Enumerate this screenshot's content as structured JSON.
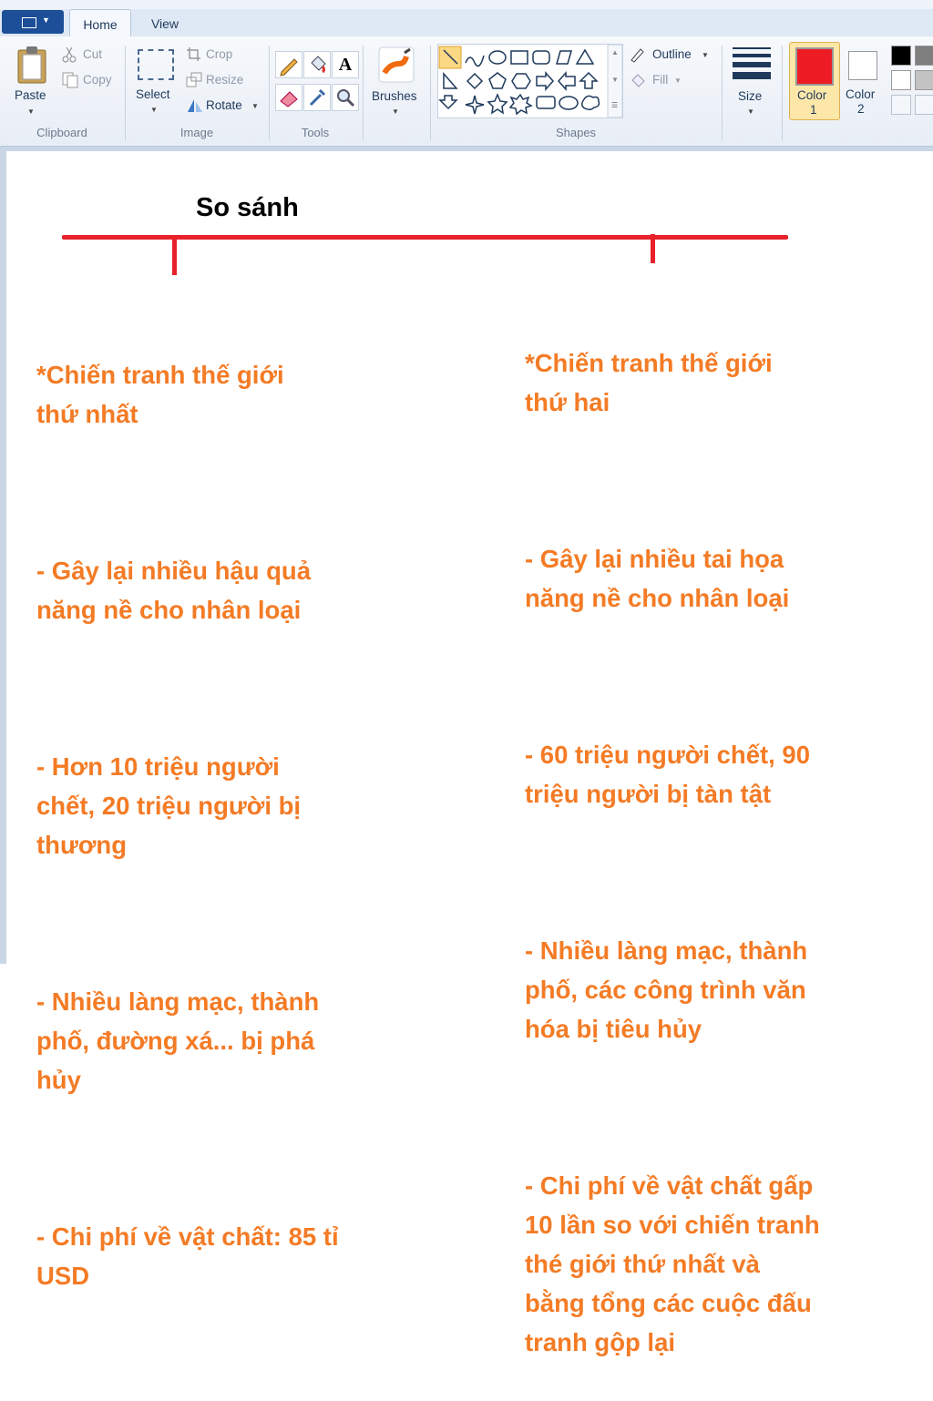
{
  "tabs": {
    "home": "Home",
    "view": "View"
  },
  "clipboard": {
    "paste": "Paste",
    "cut": "Cut",
    "copy": "Copy",
    "group": "Clipboard"
  },
  "image": {
    "select": "Select",
    "crop": "Crop",
    "resize": "Resize",
    "rotate": "Rotate",
    "group": "Image"
  },
  "tools": {
    "group": "Tools"
  },
  "brushes": {
    "label": "Brushes"
  },
  "shapes": {
    "outline": "Outline",
    "fill": "Fill",
    "group": "Shapes"
  },
  "size": {
    "label": "Size"
  },
  "colors": {
    "color1_line1": "Color",
    "color1_line2": "1",
    "color2_line1": "Color",
    "color2_line2": "2",
    "color1_value": "#ed1c24",
    "color2_value": "#ffffff",
    "accent_orange": "#f47b25",
    "line_red": "#e8212b"
  },
  "canvas": {
    "title": "So sánh",
    "left_column": [
      "*Chiến tranh thế giới\nthứ nhất",
      "- Gây lại nhiều hậu quả\nnăng nề cho nhân loại",
      "- Hơn 10 triệu người\nchết, 20 triệu người bị\nthương",
      "- Nhiều làng mạc, thành\nphố, đường xá... bị phá\nhủy",
      "- Chi phí về vật chất: 85 tỉ\nUSD"
    ],
    "right_column": [
      "*Chiến tranh thế giới\nthứ hai",
      "- Gây lại nhiều tai họa\nnăng nề cho nhân loại",
      "- 60 triệu người chết, 90\ntriệu người bị tàn tật",
      "- Nhiều làng mạc, thành\nphố, các công trình văn\nhóa bị tiêu hủy",
      "- Chi phí về vật chất gấp\n10 lần so với chiến tranh\nthé giới thứ nhất và\nbằng tổng các cuộc đấu\ntranh gộp lại"
    ]
  }
}
